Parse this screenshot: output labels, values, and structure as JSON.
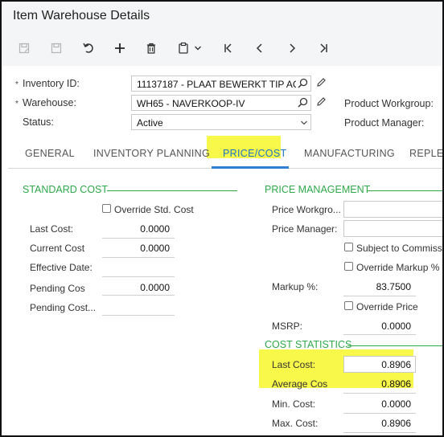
{
  "header": {
    "title": "Item Warehouse Details"
  },
  "toolbar": {
    "icons": [
      "save-icon",
      "save-close-icon",
      "undo-icon",
      "add-icon",
      "delete-icon",
      "copy-paste-icon",
      "chevron-down-icon",
      "first-icon",
      "previous-icon",
      "next-icon",
      "last-icon"
    ]
  },
  "summary": {
    "inventory_id_label": "Inventory ID:",
    "inventory_id_value": "11137187 - PLAAT BEWERKT TIP AC",
    "warehouse_label": "Warehouse:",
    "warehouse_value": "WH65 - NAVERKOOP-IV",
    "status_label": "Status:",
    "status_value": "Active",
    "product_workgroup_label": "Product Workgroup:",
    "product_manager_label": "Product Manager:",
    "required_marker": "*"
  },
  "tabs": [
    {
      "label": "GENERAL"
    },
    {
      "label": "INVENTORY PLANNING"
    },
    {
      "label": "PRICE/COST"
    },
    {
      "label": "MANUFACTURING"
    },
    {
      "label": "REPLEN"
    }
  ],
  "standard_cost": {
    "heading": "STANDARD COST",
    "override_label": "Override Std. Cost",
    "last_cost_label": "Last Cost:",
    "last_cost_value": "0.0000",
    "current_cost_label": "Current Cost",
    "current_cost_value": "0.0000",
    "effective_date_label": "Effective Date:",
    "pending_cost_label": "Pending Cos",
    "pending_cost_value": "0.0000",
    "pending_cost_date_label": "Pending Cost..."
  },
  "price_management": {
    "heading": "PRICE MANAGEMENT",
    "price_workgroup_label": "Price Workgro...",
    "price_manager_label": "Price Manager:",
    "subject_commission_label": "Subject to Commiss",
    "override_markup_label": "Override Markup %",
    "markup_label": "Markup %:",
    "markup_value": "83.7500",
    "override_price_label": "Override Price",
    "msrp_label": "MSRP:",
    "msrp_value": "0.0000"
  },
  "cost_statistics": {
    "heading": "COST STATISTICS",
    "last_cost_label": "Last Cost:",
    "last_cost_value": "0.8906",
    "average_cost_label": "Average Cos",
    "average_cost_value": "0.8906",
    "min_cost_label": "Min. Cost:",
    "min_cost_value": "0.0000",
    "max_cost_label": "Max. Cost:",
    "max_cost_value": "0.8906"
  },
  "colors": {
    "highlight": "#f8f84a",
    "section": "#2ea84a",
    "active_tab": "#1a73c8"
  }
}
